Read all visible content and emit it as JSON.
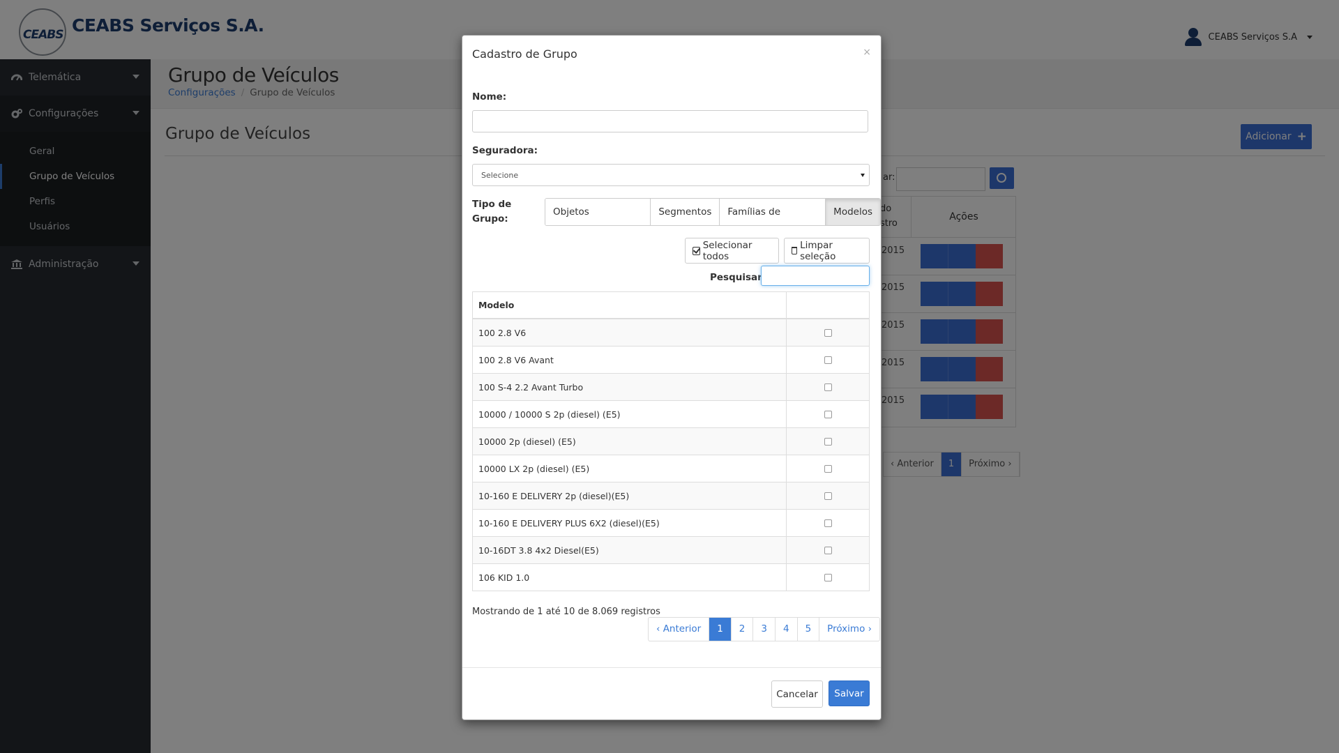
{
  "brand": {
    "name": "CEABS Serviços S.A.",
    "logo_text": "CEABS"
  },
  "user": {
    "name": "CEABS Serviços S.A"
  },
  "sidebar": {
    "items": [
      {
        "label": "Telemática",
        "icon": "dashboard-icon"
      },
      {
        "label": "Configurações",
        "icon": "cogs-icon"
      },
      {
        "label": "Administração",
        "icon": "bank-icon"
      }
    ],
    "sub_items": [
      "Geral",
      "Grupo de Veículos",
      "Perfis",
      "Usuários"
    ],
    "active_sub": "Grupo de Veículos"
  },
  "page": {
    "title": "Grupo de Veículos",
    "breadcrumb": [
      "Configurações",
      "Grupo de Veículos"
    ],
    "panel_title": "Grupo de Veículos",
    "add_label": "Adicionar",
    "bg_search_label": "ar:",
    "bg_col_head_1": "do",
    "bg_col_head_2": "stro",
    "bg_actions_head": "Ações",
    "bg_years": [
      "2015",
      "2015",
      "2015",
      "2015",
      "2015"
    ],
    "bg_pager": {
      "prev": "‹ Anterior",
      "current": "1",
      "next": "Próximo ›"
    }
  },
  "modal": {
    "title": "Cadastro de Grupo",
    "close": "×",
    "name_label": "Nome:",
    "name_value": "",
    "insurer_label": "Seguradora:",
    "insurer_value": "Selecione",
    "group_type_label_1": "Tipo de",
    "group_type_label_2": "Grupo:",
    "group_types": [
      "Objetos Rastreáveis",
      "Segmentos",
      "Famílias de Veículos",
      "Modelos"
    ],
    "active_group_type": "Modelos",
    "select_all_label": "Selecionar todos",
    "clear_label": "Limpar seleção",
    "search_label": "Pesquisar:",
    "search_value": "",
    "table_header": "Modelo",
    "rows": [
      {
        "model": "100 2.8 V6",
        "checked": false
      },
      {
        "model": "100 2.8 V6 Avant",
        "checked": false
      },
      {
        "model": "100 S-4 2.2 Avant Turbo",
        "checked": false
      },
      {
        "model": "10000 / 10000 S 2p (diesel) (E5)",
        "checked": false
      },
      {
        "model": "10000 2p (diesel) (E5)",
        "checked": false
      },
      {
        "model": "10000 LX 2p (diesel) (E5)",
        "checked": false
      },
      {
        "model": "10-160 E DELIVERY 2p (diesel)(E5)",
        "checked": false
      },
      {
        "model": "10-160 E DELIVERY PLUS 6X2 (diesel)(E5)",
        "checked": false
      },
      {
        "model": "10-16DT 3.8 4x2 Diesel(E5)",
        "checked": false
      },
      {
        "model": "106 KID 1.0",
        "checked": false
      }
    ],
    "info": "Mostrando de 1 até 10 de 8.069 registros",
    "pager": {
      "prev": "‹ Anterior",
      "pages": [
        "1",
        "2",
        "3",
        "4",
        "5"
      ],
      "current": "1",
      "next": "Próximo ›"
    },
    "cancel_label": "Cancelar",
    "save_label": "Salvar"
  }
}
